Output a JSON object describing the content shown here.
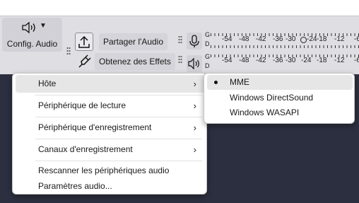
{
  "toolbar": {
    "audio_setup_label": "Config. Audio",
    "share_audio_label": "Partager l'Audio",
    "get_effects_label": "Obtenez des Effets",
    "meter": {
      "channel_top": "G",
      "channel_bottom": "D",
      "scale_top": [
        "-54",
        "-48",
        "-42",
        "-36",
        "-30",
        "-24",
        "-18",
        "-12",
        "-6"
      ],
      "scale_bottom": [
        "-54",
        "-48",
        "-42",
        "-36",
        "-30",
        "-24",
        "-18",
        "-12",
        "-6"
      ]
    }
  },
  "menu": {
    "items": [
      {
        "label": "Hôte",
        "has_submenu": true,
        "highlighted": true
      },
      {
        "label": "Périphérique de lecture",
        "has_submenu": true
      },
      {
        "label": "Périphérique d'enregistrement",
        "has_submenu": true
      },
      {
        "label": "Canaux d'enregistrement",
        "has_submenu": true
      },
      {
        "label": "Rescanner les périphériques audio",
        "has_submenu": false
      },
      {
        "label": "Paramètres audio...",
        "has_submenu": false
      }
    ],
    "submenu_arrow": "›"
  },
  "submenu": {
    "items": [
      {
        "label": "MME",
        "selected": true
      },
      {
        "label": "Windows DirectSound",
        "selected": false
      },
      {
        "label": "Windows WASAPI",
        "selected": false
      }
    ]
  }
}
